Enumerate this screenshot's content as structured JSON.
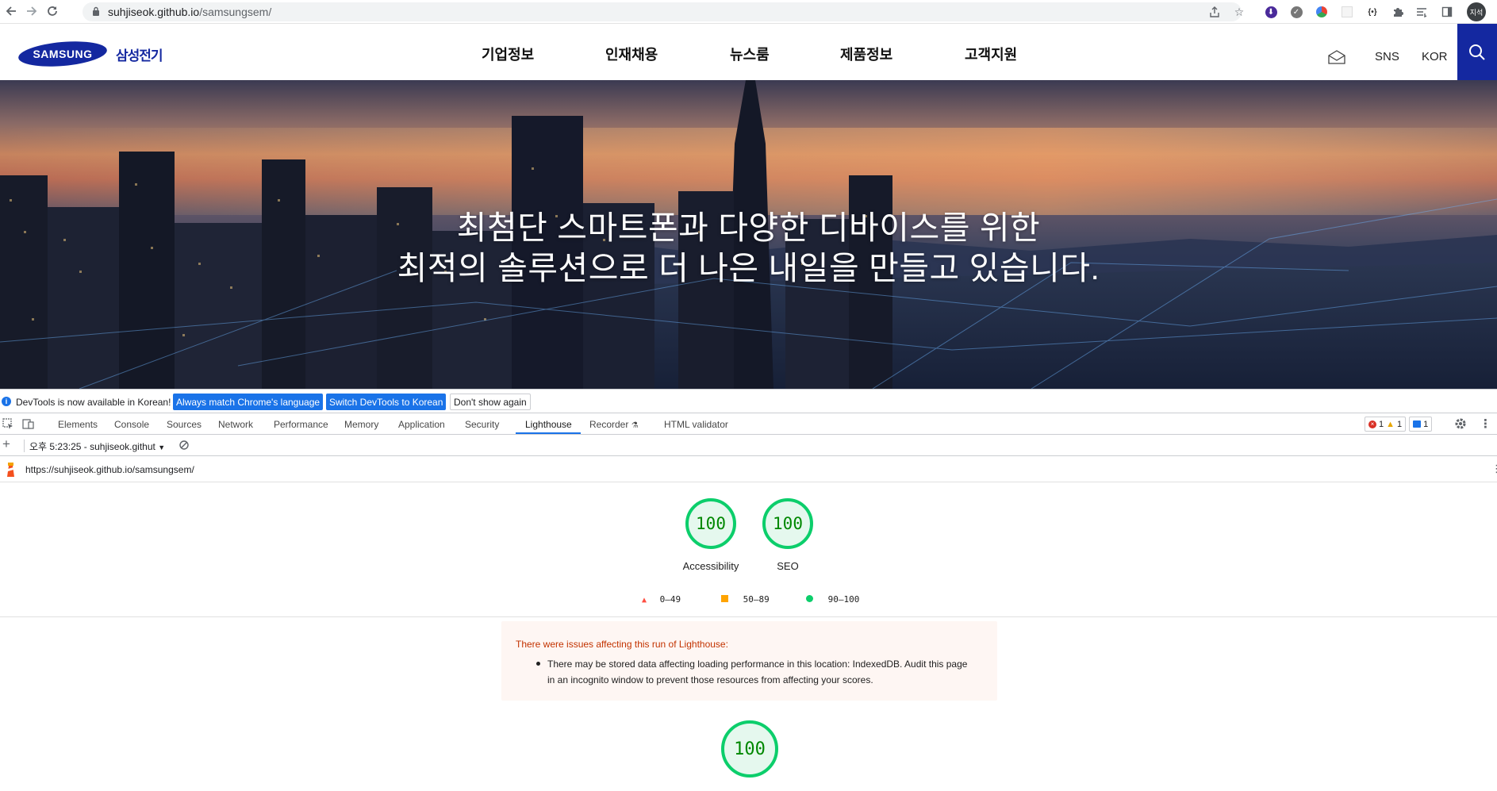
{
  "browser": {
    "url_host": "suhjiseok.github.io",
    "url_path": "/samsungsem/",
    "profile_initials": "지석",
    "colors": {
      "toolbar_icons": "#5f6368"
    }
  },
  "site": {
    "brand_logo_text": "SAMSUNG",
    "brand_kor": "삼성전기",
    "nav": [
      "기업정보",
      "인재채용",
      "뉴스룸",
      "제품정보",
      "고객지원"
    ],
    "utility": {
      "sns": "SNS",
      "language": "KOR"
    },
    "hero": {
      "line1": "최첨단 스마트폰과 다양한 디바이스를 위한",
      "line2": "최적의 솔루션으로 더 나은 내일을 만들고 있습니다."
    },
    "colors": {
      "brand_blue": "#1428a0"
    }
  },
  "devtools": {
    "banner": {
      "message": "DevTools is now available in Korean!",
      "btn_match": "Always match Chrome's language",
      "btn_switch": "Switch DevTools to Korean",
      "btn_dismiss": "Don't show again"
    },
    "tabs": [
      "Elements",
      "Console",
      "Sources",
      "Network",
      "Performance",
      "Memory",
      "Application",
      "Security",
      "Lighthouse",
      "Recorder",
      "HTML validator"
    ],
    "active_tab": "Lighthouse",
    "counts": {
      "errors": "1",
      "warnings": "1",
      "messages": "1"
    },
    "report_selector": "오후 5:23:25 - suhjiseok.githut",
    "report_url": "https://suhjiseok.github.io/samsungsem/"
  },
  "lighthouse": {
    "scores": [
      {
        "label": "Accessibility",
        "value": "100"
      },
      {
        "label": "SEO",
        "value": "100"
      }
    ],
    "legend": [
      "0–49",
      "50–89",
      "90–100"
    ],
    "warning_title": "There were issues affecting this run of Lighthouse:",
    "warning_item": "There may be stored data affecting loading performance in this location: IndexedDB. Audit this page in an incognito window to prevent those resources from affecting your scores.",
    "main_score": "100",
    "colors": {
      "pass": "#0cce6b",
      "average": "#ffa400",
      "fail": "#ff4e42"
    }
  }
}
